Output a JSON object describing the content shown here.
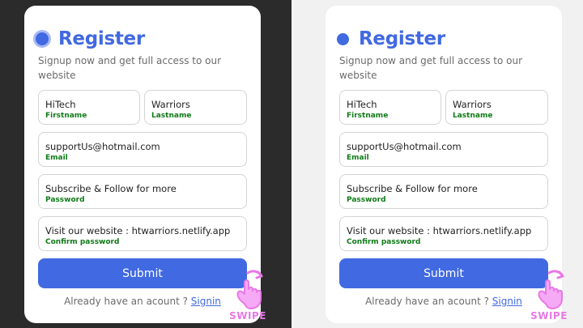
{
  "form": {
    "title": "Register",
    "subtitle": "Signup now and get full access to our website",
    "fields": {
      "firstname": {
        "value": "HiTech",
        "label": "Firstname"
      },
      "lastname": {
        "value": "Warriors",
        "label": "Lastname"
      },
      "email": {
        "value": "supportUs@hotmail.com",
        "label": "Email"
      },
      "password": {
        "value": "Subscribe & Follow for more",
        "label": "Password"
      },
      "confirm": {
        "value": "Visit our website : htwarriors.netlify.app",
        "label": "Confirm password"
      }
    },
    "submit_label": "Submit",
    "signin_prompt": "Already have an acount ?",
    "signin_link": "Signin"
  },
  "overlay": {
    "swipe_text": "SWIPE",
    "swipe_icon": "hand-swipe-icon"
  },
  "colors": {
    "accent": "#4169e1",
    "label_green": "#0f7a17",
    "swipe_pink": "#e879e6",
    "left_background": "#2b2b2b",
    "right_background": "#f1f1f1"
  }
}
